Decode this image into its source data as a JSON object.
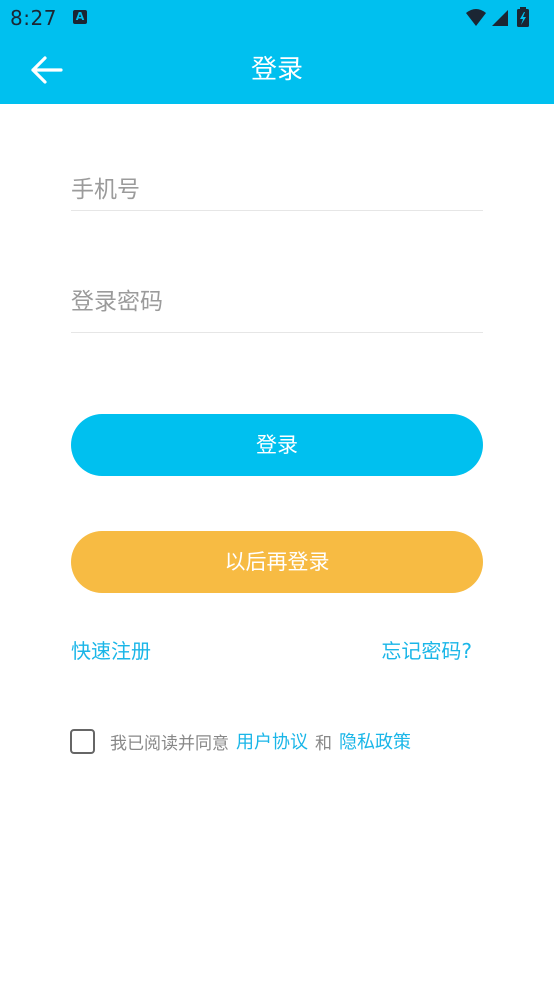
{
  "status_bar": {
    "time": "8:27",
    "notification_icon": "A"
  },
  "header": {
    "title": "登录",
    "bg_color": "#00c0ef"
  },
  "form": {
    "phone_placeholder": "手机号",
    "password_placeholder": "登录密码"
  },
  "buttons": {
    "login_label": "登录",
    "later_label": "以后再登录",
    "login_color": "#00c0ef",
    "later_color": "#f7bb43"
  },
  "links": {
    "register": "快速注册",
    "forgot_password": "忘记密码?"
  },
  "agreement": {
    "prefix": "我已阅读并同意",
    "user_agreement": "用户协议",
    "and": "和",
    "privacy_policy": "隐私政策"
  }
}
